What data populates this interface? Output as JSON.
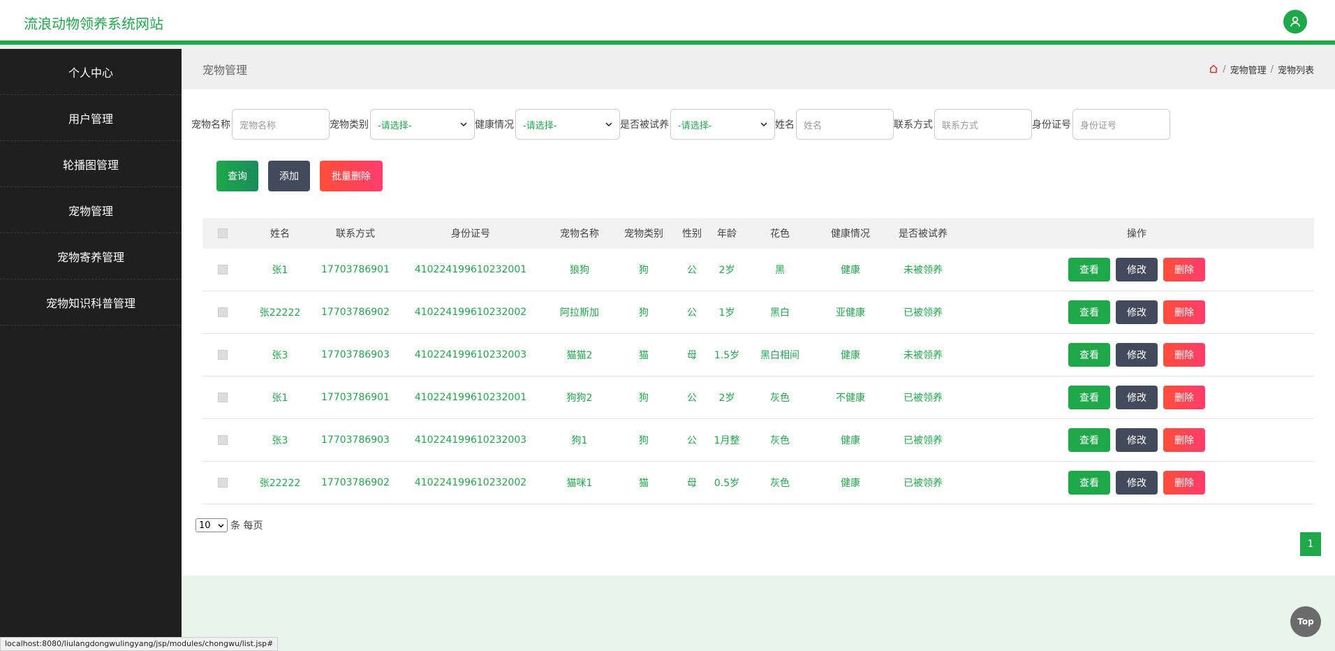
{
  "header": {
    "brand": "流浪动物领养系统网站",
    "user_icon": "user-icon"
  },
  "sidebar": {
    "items": [
      "个人中心",
      "用户管理",
      "轮播图管理",
      "宠物管理",
      "宠物寄养管理",
      "宠物知识科普管理"
    ]
  },
  "main": {
    "title": "宠物管理",
    "breadcrumb": {
      "home_icon": "home-icon",
      "sep": "/",
      "level1": "宠物管理",
      "level2": "宠物列表"
    }
  },
  "search": {
    "pet_name_label": "宠物名称",
    "pet_name_placeholder": "宠物名称",
    "pet_type_label": "宠物类别",
    "pet_type_value": "-请选择-",
    "health_label": "健康情况",
    "health_value": "-请选择-",
    "adopted_label": "是否被试养",
    "adopted_value": "-请选择-",
    "name_label": "姓名",
    "name_placeholder": "姓名",
    "contact_label": "联系方式",
    "contact_placeholder": "联系方式",
    "id_label": "身份证号",
    "id_placeholder": "身份证号"
  },
  "buttons": {
    "query": "查询",
    "add": "添加",
    "batch_delete": "批量删除"
  },
  "table": {
    "headers": [
      "姓名",
      "联系方式",
      "身份证号",
      "宠物名称",
      "宠物类别",
      "性别",
      "年龄",
      "花色",
      "健康情况",
      "是否被试养",
      "操作"
    ],
    "rows": [
      [
        "张1",
        "17703786901",
        "410224199610232001",
        "狼狗",
        "狗",
        "公",
        "2岁",
        "黑",
        "健康",
        "未被领养"
      ],
      [
        "张22222",
        "17703786902",
        "410224199610232002",
        "阿拉斯加",
        "狗",
        "公",
        "1岁",
        "黑白",
        "亚健康",
        "已被领养"
      ],
      [
        "张3",
        "17703786903",
        "410224199610232003",
        "猫猫2",
        "猫",
        "母",
        "1.5岁",
        "黑白相间",
        "健康",
        "未被领养"
      ],
      [
        "张1",
        "17703786901",
        "410224199610232001",
        "狗狗2",
        "狗",
        "公",
        "2岁",
        "灰色",
        "不健康",
        "已被领养"
      ],
      [
        "张3",
        "17703786903",
        "410224199610232003",
        "狗1",
        "狗",
        "公",
        "1月整",
        "灰色",
        "健康",
        "已被领养"
      ],
      [
        "张22222",
        "17703786902",
        "410224199610232002",
        "猫咪1",
        "猫",
        "母",
        "0.5岁",
        "灰色",
        "健康",
        "已被领养"
      ]
    ],
    "actions": {
      "view": "查看",
      "edit": "修改",
      "delete": "删除"
    }
  },
  "pager": {
    "page_size": "10",
    "suffix": "条 每页",
    "current_page": "1"
  },
  "misc": {
    "top_button": "Top",
    "status_url": "localhost:8080/liulangdongwulingyang/jsp/modules/chongwu/list.jsp#"
  },
  "colors": {
    "accent": "#1ea84a",
    "sidebar_bg": "#1f1f1f",
    "danger": "#ff4e3a",
    "dark_button": "#434a5c"
  }
}
